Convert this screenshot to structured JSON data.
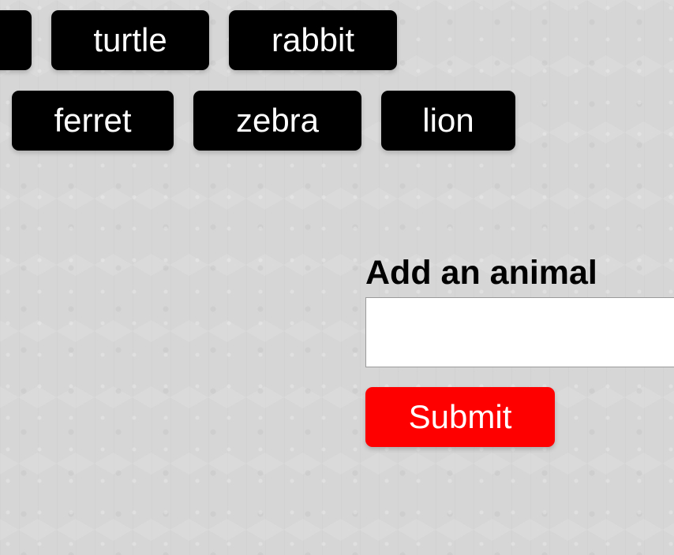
{
  "animals": {
    "row1": [
      "",
      "turtle",
      "rabbit"
    ],
    "row2": [
      "ferret",
      "zebra",
      "lion"
    ]
  },
  "form": {
    "label": "Add an animal",
    "input_value": "",
    "submit_label": "Submit"
  },
  "colors": {
    "tag_background": "#000000",
    "tag_text": "#ffffff",
    "submit_background": "#ff0000",
    "page_background": "#d6d6d6"
  }
}
